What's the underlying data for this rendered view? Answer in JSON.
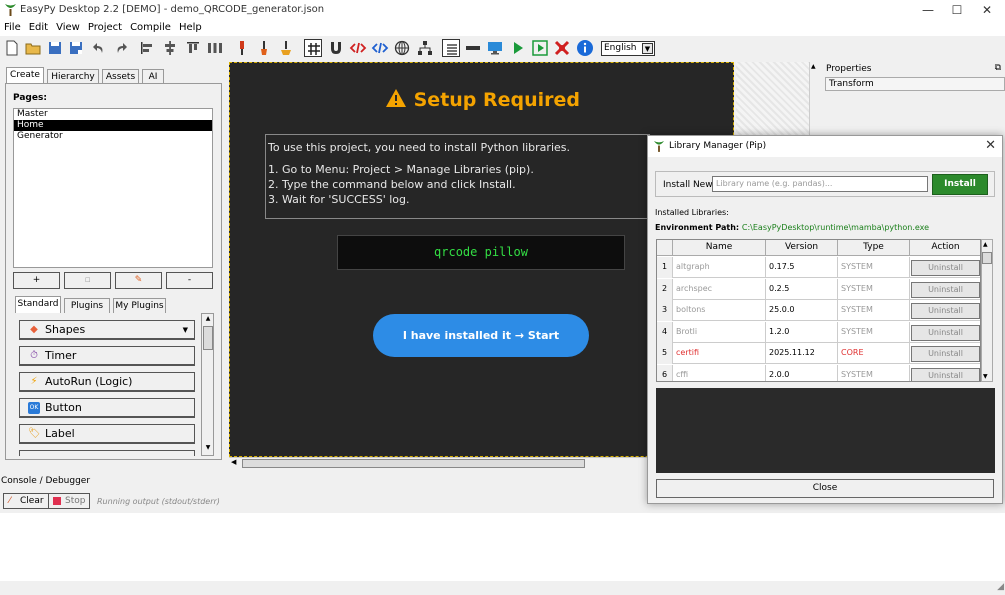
{
  "window": {
    "title": "EasyPy Desktop 2.2 [DEMO] - demo_QRCODE_generator.json"
  },
  "menu": [
    "File",
    "Edit",
    "View",
    "Project",
    "Compile",
    "Help"
  ],
  "toolbar": {
    "language": "English"
  },
  "left_panel": {
    "tabs": [
      "Create",
      "Hierarchy",
      "Assets",
      "AI"
    ],
    "pages_label": "Pages:",
    "pages": [
      "Master",
      "Home",
      "Generator"
    ],
    "selected_page": "Home",
    "page_buttons": [
      "+",
      "",
      "",
      "-"
    ],
    "component_tabs": [
      "Standard",
      "Plugins",
      "My Plugins"
    ],
    "components": [
      "Shapes",
      "Timer",
      "AutoRun (Logic)",
      "Button",
      "Label"
    ]
  },
  "canvas": {
    "setup_title": "Setup Required",
    "info_lines": [
      "To use this project, you need to install Python libraries.",
      "",
      "1. Go to Menu: Project > Manage Libraries (pip).",
      "2. Type the command below and click Install.",
      "3. Wait for 'SUCCESS' log."
    ],
    "command": "qrcode pillow",
    "start_button": "I have installed it → Start"
  },
  "properties": {
    "title": "Properties",
    "transform": "Transform"
  },
  "console": {
    "label": "Console / Debugger",
    "clear": "Clear",
    "stop": "Stop",
    "status": "Running output (stdout/stderr)"
  },
  "dialog": {
    "title": "Library Manager (Pip)",
    "install_label": "Install New:",
    "input_placeholder": "Library name (e.g. pandas)...",
    "install_button": "Install",
    "installed_label": "Installed Libraries:",
    "env_label": "Environment Path:",
    "env_path": "C:\\EasyPyDesktop\\runtime\\mamba\\python.exe",
    "columns": [
      "Name",
      "Version",
      "Type",
      "Action"
    ],
    "rows": [
      {
        "num": "1",
        "name": "altgraph",
        "version": "0.17.5",
        "type": "SYSTEM",
        "action": "Uninstall"
      },
      {
        "num": "2",
        "name": "archspec",
        "version": "0.2.5",
        "type": "SYSTEM",
        "action": "Uninstall"
      },
      {
        "num": "3",
        "name": "boltons",
        "version": "25.0.0",
        "type": "SYSTEM",
        "action": "Uninstall"
      },
      {
        "num": "4",
        "name": "Brotli",
        "version": "1.2.0",
        "type": "SYSTEM",
        "action": "Uninstall"
      },
      {
        "num": "5",
        "name": "certifi",
        "version": "2025.11.12",
        "type": "CORE",
        "action": "Uninstall"
      },
      {
        "num": "6",
        "name": "cffi",
        "version": "2.0.0",
        "type": "SYSTEM",
        "action": "Uninstall"
      }
    ],
    "close_button": "Close"
  },
  "colors": {
    "accent_orange": "#f4a300",
    "start_blue": "#2d8ce6",
    "command_green": "#33dd44",
    "install_green": "#2c8a2c",
    "core_red": "#e03030",
    "system_gray": "#999999"
  }
}
